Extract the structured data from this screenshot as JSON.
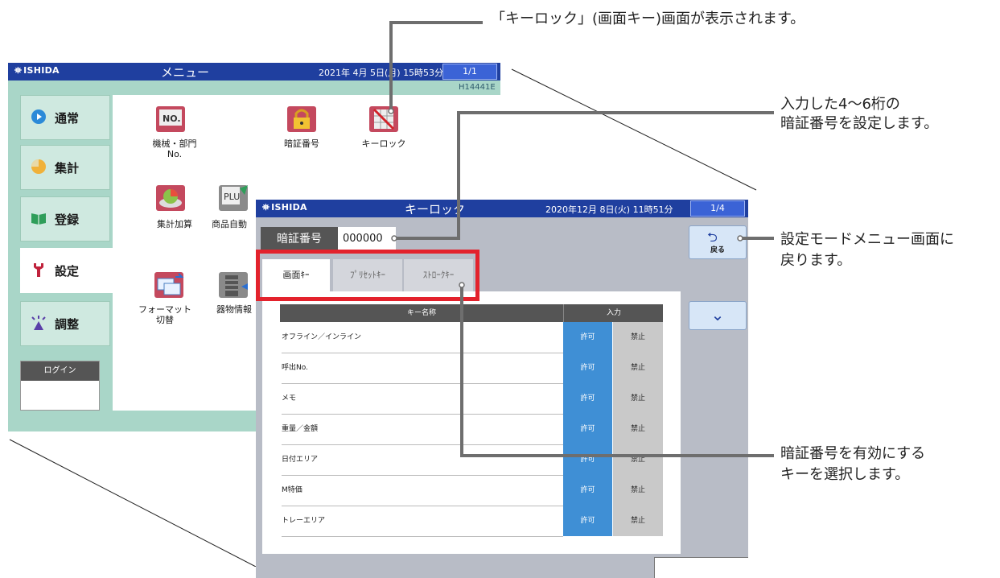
{
  "callouts": {
    "top": "「キーロック」(画面キー)画面が表示されます。",
    "pin_line1": "入力した4〜6桁の",
    "pin_line2": "暗証番号を設定します。",
    "back_line1": "設定モードメニュー画面に",
    "back_line2": "戻ります。",
    "keys_line1": "暗証番号を有効にする",
    "keys_line2": "キーを選択します。"
  },
  "menu": {
    "logo": "ISHIDA",
    "title": "メニュー",
    "datetime": "2021年 4月 5日(月)  15時53分",
    "page": "1/1",
    "code": "H14441E",
    "sidebar": [
      {
        "label": "通常"
      },
      {
        "label": "集計"
      },
      {
        "label": "登録"
      },
      {
        "label": "設定"
      },
      {
        "label": "調整"
      }
    ],
    "login": "ログイン",
    "icons": [
      {
        "label": "機械・部門\nNo.",
        "label1": "機械・部門",
        "label2": "No."
      },
      {
        "label1": "暗証番号"
      },
      {
        "label1": "キーロック"
      },
      {
        "label1": "集計加算"
      },
      {
        "label1": "商品自動"
      },
      {
        "label1": "フォーマット",
        "label2": "切替"
      },
      {
        "label1": "器物情報"
      }
    ]
  },
  "lock": {
    "logo": "ISHIDA",
    "title": "キーロック",
    "datetime": "2020年12月 8日(火)  11時51分",
    "page": "1/4",
    "pin_label": "暗証番号",
    "pin_value": "000000",
    "back_label": "戻る",
    "tabs": [
      {
        "label": "画面ｷｰ"
      },
      {
        "label": "ﾌﾟﾘｾｯﾄｷｰ"
      },
      {
        "label": "ｽﾄﾛｰｸｷｰ"
      }
    ],
    "table_headers": {
      "name": "キー名称",
      "input": "入力"
    },
    "rows": [
      {
        "name": "オフライン／インライン",
        "allow": "許可",
        "deny": "禁止"
      },
      {
        "name": "呼出No.",
        "allow": "許可",
        "deny": "禁止"
      },
      {
        "name": "メモ",
        "allow": "許可",
        "deny": "禁止"
      },
      {
        "name": "重量／金額",
        "allow": "許可",
        "deny": "禁止"
      },
      {
        "name": "日付エリア",
        "allow": "許可",
        "deny": "禁止"
      },
      {
        "name": "M特価",
        "allow": "許可",
        "deny": "禁止"
      },
      {
        "name": "トレーエリア",
        "allow": "許可",
        "deny": "禁止"
      }
    ]
  },
  "colors": {
    "titlebar": "#1f3f9f",
    "allow": "#3f8fd5",
    "deny": "#c9c9c9",
    "highlight": "#e3222c",
    "menu_bg": "#a9d6c8"
  }
}
